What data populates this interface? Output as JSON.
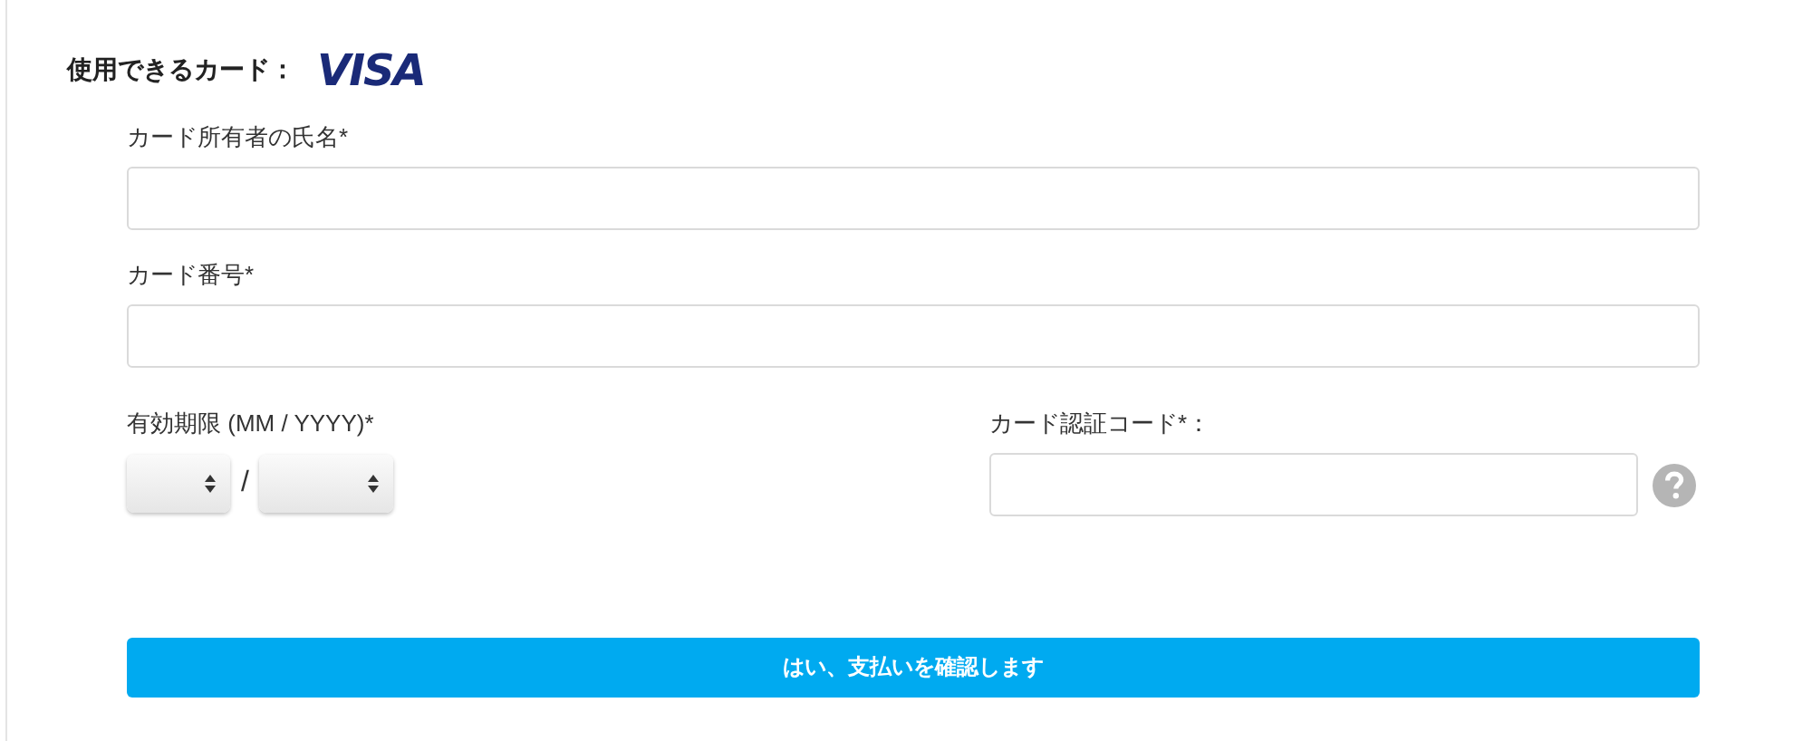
{
  "heading": {
    "label": "使用できるカード：",
    "brand": "VISA"
  },
  "fields": [
    {
      "kind": "text",
      "label": "カード所有者の氏名*"
    },
    {
      "kind": "text",
      "label": "カード番号*"
    }
  ],
  "expiry": {
    "label": "有効期限 (MM / YYYY)*",
    "separator": "/"
  },
  "security_code": {
    "label": "カード認証コード*："
  },
  "confirm_button": "はい、支払いを確認します"
}
